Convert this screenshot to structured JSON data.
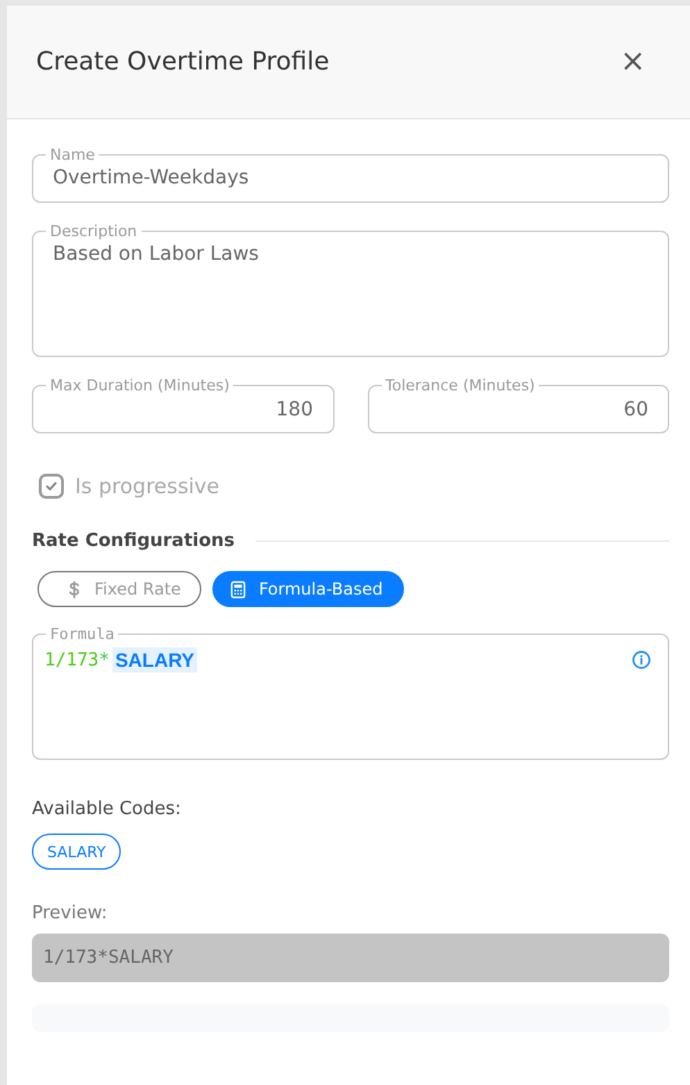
{
  "dialog": {
    "title": "Create Overtime Profile",
    "close": "×"
  },
  "fields": {
    "name": {
      "label": "Name",
      "value": "Overtime-Weekdays"
    },
    "description": {
      "label": "Description",
      "value": "Based on Labor Laws"
    },
    "max_duration": {
      "label": "Max Duration (Minutes)",
      "value": "180"
    },
    "tolerance": {
      "label": "Tolerance (Minutes)",
      "value": "60"
    }
  },
  "progressive": {
    "label": "Is progressive",
    "checked": true,
    "disabled": true
  },
  "rate_section": {
    "title": "Rate Configurations",
    "modes": [
      {
        "label": "Fixed Rate",
        "kind": "dollar",
        "selected": false
      },
      {
        "label": "Formula-Based",
        "kind": "calculator",
        "selected": true
      }
    ]
  },
  "formula": {
    "label": "Formula",
    "tokens": [
      {
        "text": "1/173",
        "kind": "number"
      },
      {
        "text": "*",
        "kind": "operator"
      },
      {
        "text": "SALARY",
        "kind": "code"
      }
    ]
  },
  "available_codes": {
    "label": "Available Codes:",
    "codes": [
      "SALARY"
    ]
  },
  "preview": {
    "label": "Preview:",
    "value": "1/173*SALARY"
  }
}
